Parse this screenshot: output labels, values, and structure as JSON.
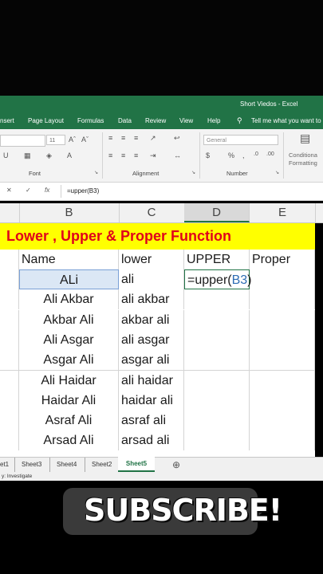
{
  "window": {
    "title": "Short Viedos  -  Excel"
  },
  "ribbon_tabs": [
    "nsert",
    "Page Layout",
    "Formulas",
    "Data",
    "Review",
    "View",
    "Help",
    "Tell me what you want to"
  ],
  "ribbon": {
    "font_size": "11",
    "number_format": "General",
    "group_font": "Font",
    "group_alignment": "Alignment",
    "group_number": "Number",
    "conditional_line1": "Conditiona",
    "conditional_line2": "Formatting"
  },
  "formula_bar": {
    "content": "=upper(B3)",
    "fx": "fx"
  },
  "columns": [
    "B",
    "C",
    "D",
    "E"
  ],
  "banner": "Lower , Upper & Proper Function",
  "headers": {
    "name": "Name",
    "lower": "lower",
    "upper": "UPPER",
    "proper": "Proper"
  },
  "rows": [
    {
      "name": "ALi",
      "lower": "ali"
    },
    {
      "name": "Ali Akbar",
      "lower": "ali akbar"
    },
    {
      "name": "Akbar Ali",
      "lower": "akbar ali"
    },
    {
      "name": "Ali Asgar",
      "lower": "ali asgar"
    },
    {
      "name": "Asgar Ali",
      "lower": "asgar ali"
    },
    {
      "name": "Ali Haidar",
      "lower": "ali haidar"
    },
    {
      "name": "Haidar Ali",
      "lower": "haidar ali"
    },
    {
      "name": "Asraf Ali",
      "lower": "asraf ali"
    },
    {
      "name": "Arsad Ali",
      "lower": "arsad ali"
    }
  ],
  "editing": {
    "prefix": "=upper(",
    "ref": "B3",
    "suffix": ")"
  },
  "sheet_tabs": [
    "et1",
    "Sheet3",
    "Sheet4",
    "Sheet2",
    "Sheet5"
  ],
  "active_sheet": "Sheet5",
  "status_text": "y: Investigate",
  "overlay": {
    "subscribe": "SUBSCRIBE!"
  },
  "colors": {
    "excel_green": "#217346",
    "banner_bg": "#ffff00",
    "banner_text": "#e0001b",
    "ref_blue": "#2e6db4"
  }
}
